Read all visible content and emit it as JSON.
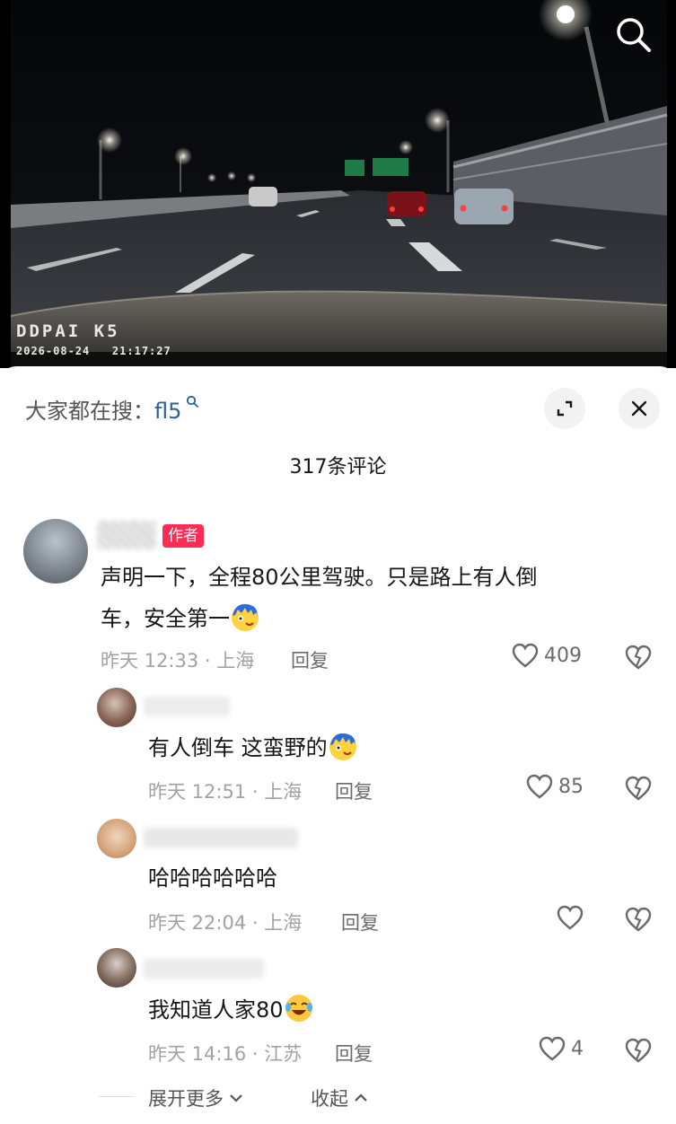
{
  "video": {
    "brand": "DDPAI K5",
    "timestamp": "2026-08-24   21:17:27",
    "icon": "search-icon"
  },
  "sheet": {
    "hot_search_label": "大家都在搜：",
    "hot_search_keyword": "fl5",
    "count_title": "317条评论",
    "expand_icon": "expand-icon",
    "close_icon": "close-icon"
  },
  "comments": [
    {
      "author_tag": "作者",
      "text_line1": "声明一下，全程80公里驾驶。只是路上有人倒",
      "text_line2": "车，安全第一",
      "time": "昨天 12:33 · 上海",
      "reply": "回复",
      "likes": "409"
    },
    {
      "text": "有人倒车 这蛮野的",
      "time": "昨天 12:51 · 上海",
      "reply": "回复",
      "likes": "85"
    },
    {
      "text": "哈哈哈哈哈哈",
      "time": "昨天 22:04 · 上海",
      "reply": "回复",
      "likes": ""
    },
    {
      "text": "我知道人家80",
      "time": "昨天 14:16 · 江苏",
      "reply": "回复",
      "likes": "4"
    }
  ],
  "footer": {
    "expand_more": "展开更多",
    "collapse": "收起"
  },
  "colors": {
    "accent": "#fe2c55",
    "keyword": "#2f5d99"
  }
}
